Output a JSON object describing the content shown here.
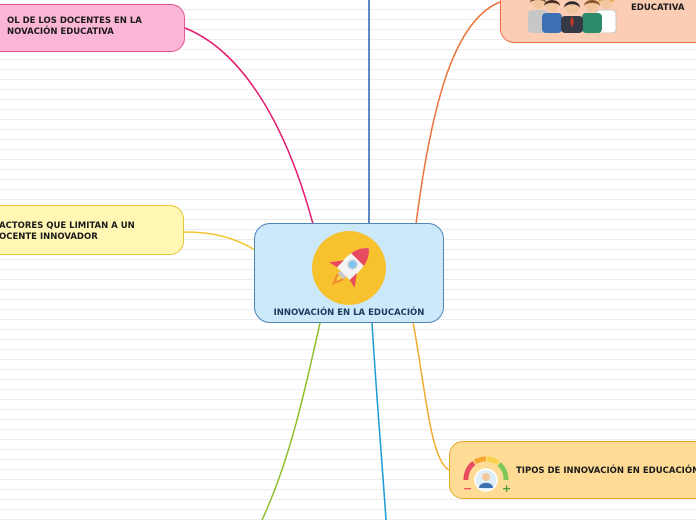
{
  "mindmap": {
    "center": {
      "label": "INNOVACIÓN EN LA EDUCACIÓN",
      "icon": "rocket-icon"
    },
    "branches": [
      {
        "label": "OL DE LOS DOCENTES EN LA\nNOVACIÓN EDUCATIVA",
        "color": "#e2196f"
      },
      {
        "label": "ACTORES QUE LIMITAN A UN\nOCENTE INNOVADOR",
        "color": "#f2c531"
      },
      {
        "label": "EDUCATIVA",
        "color": "#e8743b",
        "icon": "people-group-icon"
      },
      {
        "label": "TIPOS DE INNOVACIÓN EN EDUCACIÓN",
        "color": "#f0ad2b",
        "icon": "gauge-icon"
      }
    ],
    "connector_colors": {
      "top": "#2a63b0",
      "bottom_left": "#8cbf2a",
      "bottom": "#1d9ad6"
    }
  }
}
